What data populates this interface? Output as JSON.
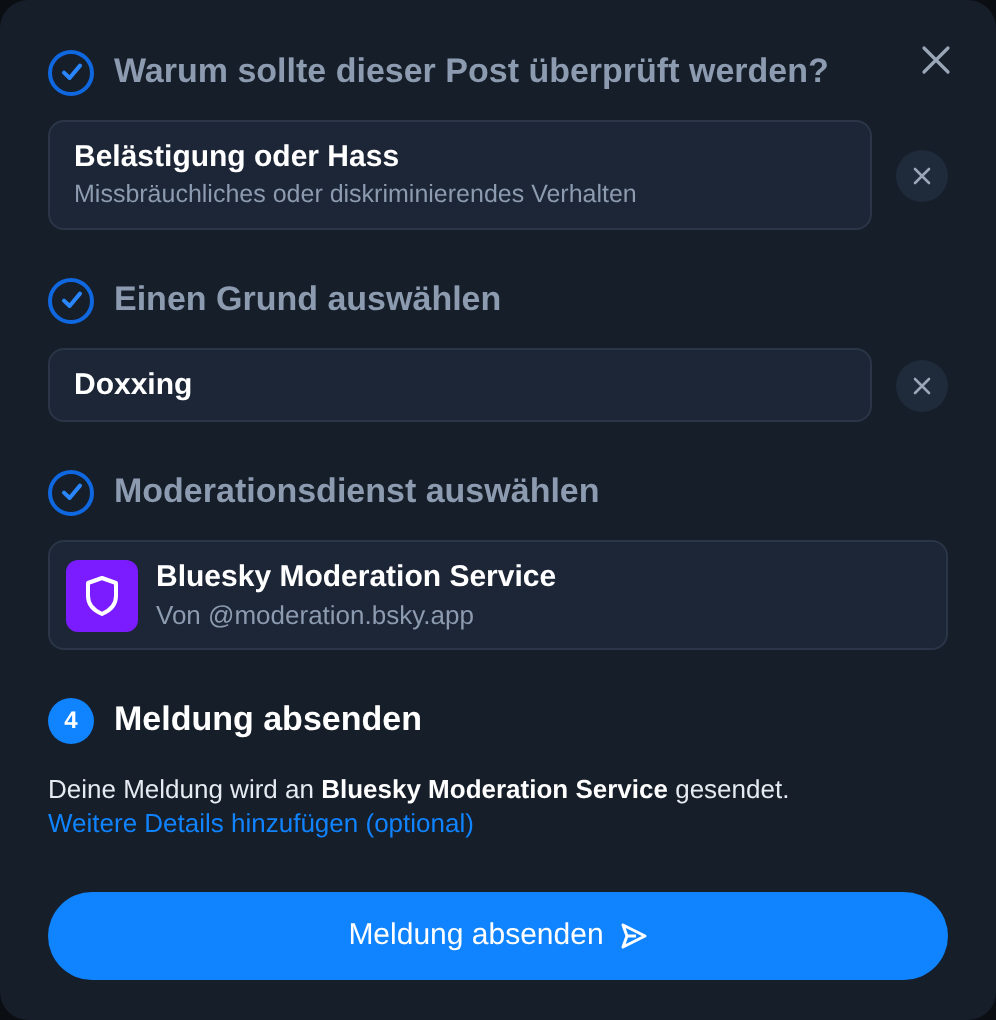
{
  "steps": [
    {
      "kind": "done",
      "title": "Warum sollte dieser Post überprüft werden?",
      "selection": {
        "kind": "option",
        "title": "Belästigung oder Hass",
        "description": "Missbräuchliches oder diskriminierendes Verhalten"
      }
    },
    {
      "kind": "done",
      "title": "Einen Grund auswählen",
      "selection": {
        "kind": "option",
        "title": "Doxxing"
      }
    },
    {
      "kind": "done",
      "title": "Moderationsdienst auswählen",
      "selection": {
        "kind": "service",
        "title": "Bluesky Moderation Service",
        "description": "Von @moderation.bsky.app"
      }
    },
    {
      "kind": "current",
      "number": "4",
      "title": "Meldung absenden",
      "message": "Deine Meldung wird an **Bluesky Moderation Service** gesendet.",
      "link": "Weitere Details hinzufügen (optional)",
      "button": "Meldung absenden"
    }
  ]
}
